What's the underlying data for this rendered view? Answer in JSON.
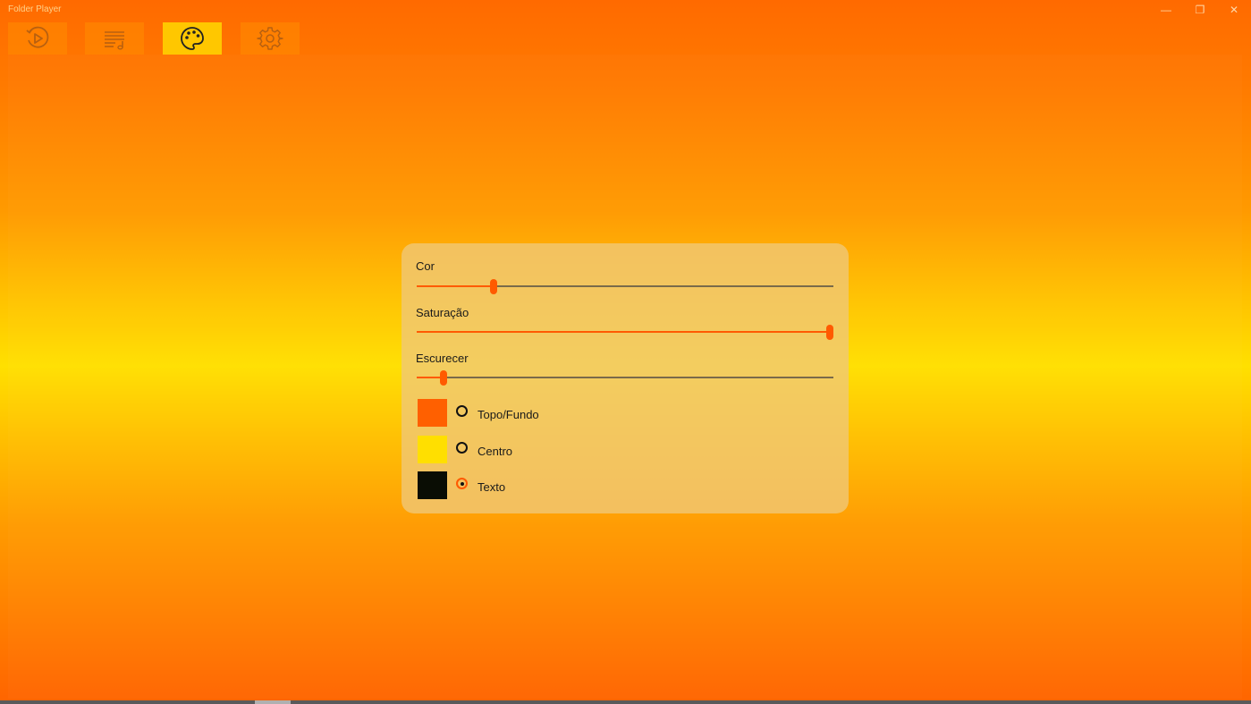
{
  "window": {
    "title": "Folder Player",
    "minimize_glyph": "—",
    "maximize_glyph": "❐",
    "close_glyph": "✕"
  },
  "toolbar": {
    "items": [
      {
        "name": "play-icon",
        "active": false
      },
      {
        "name": "playlist-icon",
        "active": false
      },
      {
        "name": "palette-icon",
        "active": true
      },
      {
        "name": "gear-icon",
        "active": false
      }
    ]
  },
  "theme": {
    "sliders": [
      {
        "label": "Cor",
        "value": 0.185
      },
      {
        "label": "Saturação",
        "value": 1.0
      },
      {
        "label": "Escurecer",
        "value": 0.065
      }
    ],
    "color_targets": [
      {
        "label": "Topo/Fundo",
        "color": "#ff6000",
        "checked": false
      },
      {
        "label": "Centro",
        "color": "#ffdf00",
        "checked": false
      },
      {
        "label": "Texto",
        "color": "#0a0d04",
        "checked": true
      }
    ],
    "accent": "#ff5a00"
  }
}
